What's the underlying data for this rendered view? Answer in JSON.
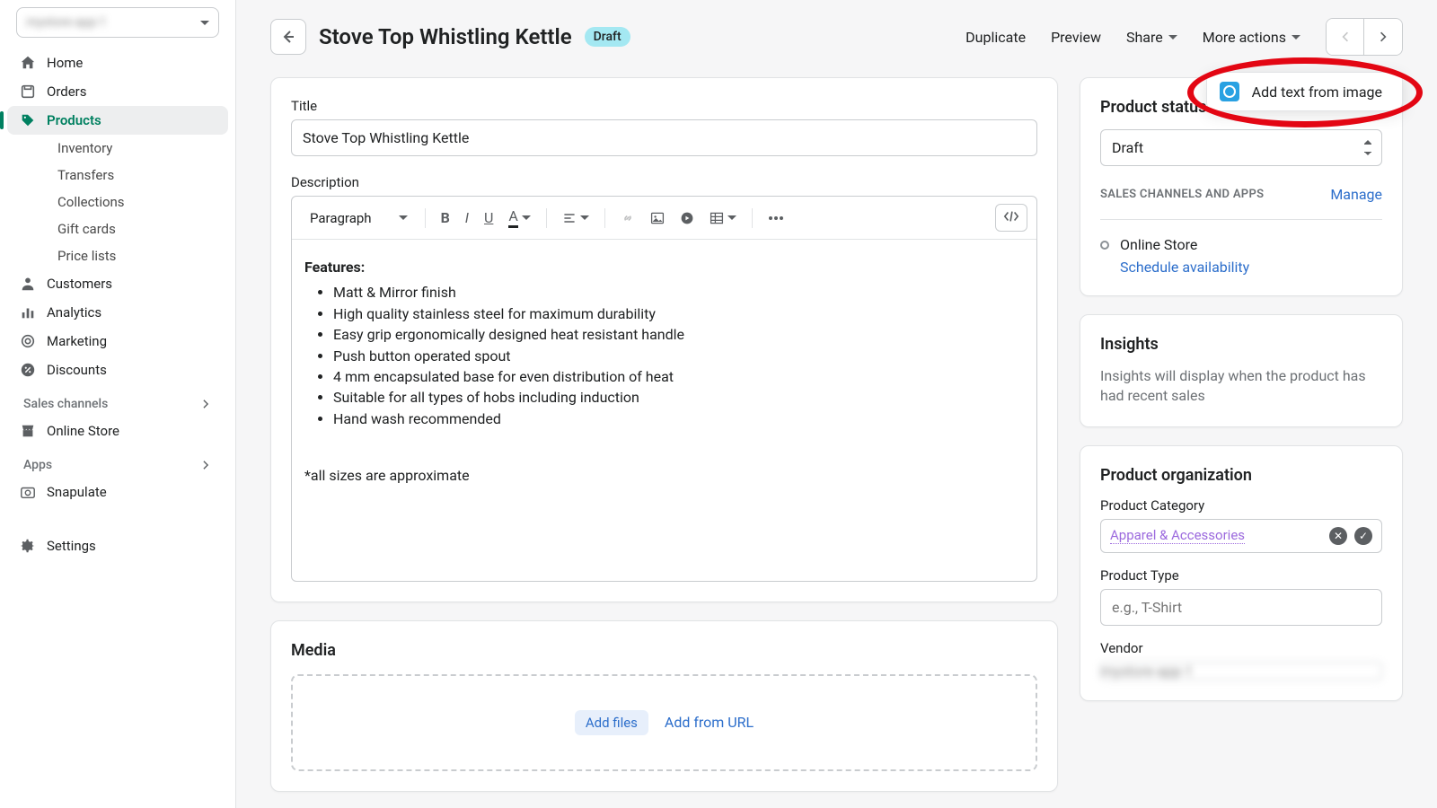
{
  "sidebar": {
    "store_name": "mystore-app-1",
    "nav": {
      "home": "Home",
      "orders": "Orders",
      "products": "Products",
      "inventory": "Inventory",
      "transfers": "Transfers",
      "collections": "Collections",
      "giftcards": "Gift cards",
      "pricelists": "Price lists",
      "customers": "Customers",
      "analytics": "Analytics",
      "marketing": "Marketing",
      "discounts": "Discounts",
      "sales_channels": "Sales channels",
      "online_store": "Online Store",
      "apps": "Apps",
      "snapulate": "Snapulate",
      "settings": "Settings"
    }
  },
  "header": {
    "title": "Stove Top Whistling Kettle",
    "badge": "Draft",
    "duplicate": "Duplicate",
    "preview": "Preview",
    "share": "Share",
    "more": "More actions",
    "popover": "Add text from image"
  },
  "main": {
    "title_label": "Title",
    "title_value": "Stove Top Whistling Kettle",
    "desc_label": "Description",
    "para": "Paragraph",
    "features_heading": "Features:",
    "features": [
      "Matt & Mirror finish",
      "High quality stainless steel for maximum durability",
      "Easy grip ergonomically designed heat resistant handle",
      "Push button operated spout",
      "4 mm encapsulated base for even distribution of heat",
      "Suitable for all types of hobs including induction",
      "Hand wash recommended"
    ],
    "footnote": "*all sizes are approximate",
    "media_title": "Media",
    "add_files": "Add files",
    "add_url": "Add from URL"
  },
  "side": {
    "status_title": "Product status",
    "status_value": "Draft",
    "sc_heading": "SALES CHANNELS AND APPS",
    "manage": "Manage",
    "online_store": "Online Store",
    "schedule": "Schedule availability",
    "insights_title": "Insights",
    "insights_body": "Insights will display when the product has had recent sales",
    "org_title": "Product organization",
    "cat_label": "Product Category",
    "cat_value": "Apparel & Accessories",
    "type_label": "Product Type",
    "type_ph": "e.g., T-Shirt",
    "vendor_label": "Vendor",
    "vendor_value": "mystore-app-1"
  }
}
